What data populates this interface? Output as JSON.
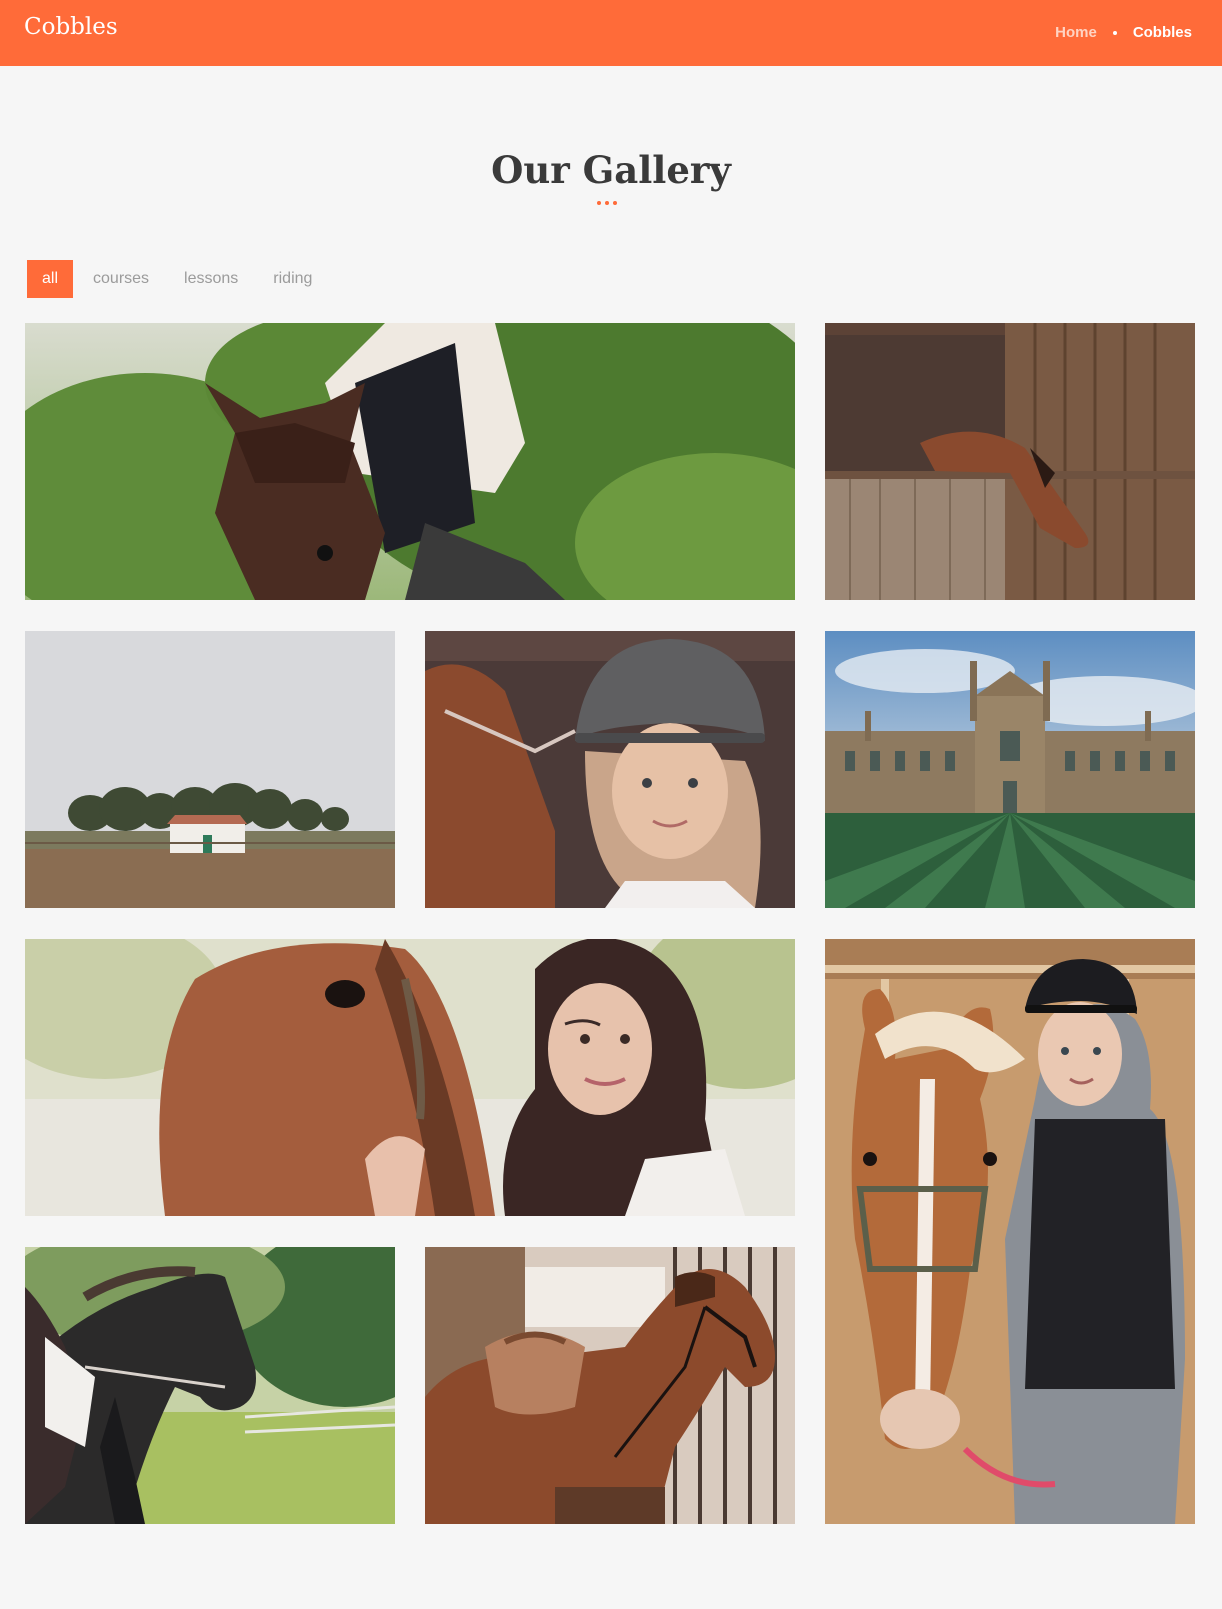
{
  "header": {
    "logo": "Cobbles",
    "breadcrumb": [
      {
        "label": "Home"
      },
      {
        "label": "Cobbles"
      }
    ],
    "color": "#ff6b39"
  },
  "gallery": {
    "title": "Our Gallery",
    "filters": [
      {
        "label": "all",
        "active": true
      },
      {
        "label": "courses",
        "active": false
      },
      {
        "label": "lessons",
        "active": false
      },
      {
        "label": "riding",
        "active": false
      }
    ],
    "images": [
      "girl-riding-horse-in-trees",
      "horse-head-over-stable-door",
      "farmhouse-and-trees-in-field",
      "girl-in-riding-helmet",
      "college-building-and-lawn",
      "woman-with-horse-close-up",
      "girl-in-helmet-with-pony",
      "rider-on-dark-horse",
      "saddled-horse-in-stable"
    ]
  }
}
